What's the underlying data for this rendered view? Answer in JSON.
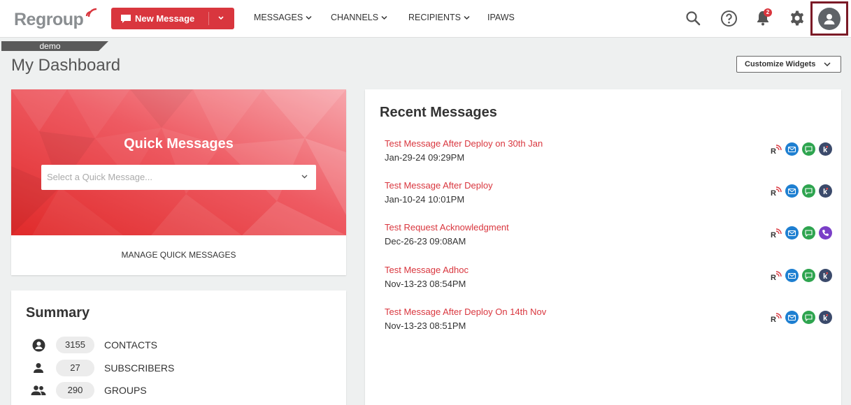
{
  "header": {
    "logo_text": "Regroup",
    "new_message_label": "New Message",
    "nav": [
      {
        "label": "MESSAGES"
      },
      {
        "label": "CHANNELS"
      },
      {
        "label": "RECIPIENTS"
      },
      {
        "label": "IPAWS"
      }
    ],
    "notification_count": "2",
    "icons": [
      "search-icon",
      "help-icon",
      "bell-icon",
      "gear-icon",
      "user-avatar-icon"
    ]
  },
  "org_tag": "demo",
  "page_title": "My Dashboard",
  "customize_label": "Customize Widgets",
  "quick_messages": {
    "title": "Quick Messages",
    "select_placeholder": "Select a Quick Message...",
    "manage_label": "MANAGE QUICK MESSAGES"
  },
  "summary": {
    "title": "Summary",
    "rows": [
      {
        "icon": "contact-circle-icon",
        "count": "3155",
        "label": "CONTACTS"
      },
      {
        "icon": "person-icon",
        "count": "27",
        "label": "SUBSCRIBERS"
      },
      {
        "icon": "group-icon",
        "count": "290",
        "label": "GROUPS"
      }
    ]
  },
  "recent_messages": {
    "title": "Recent Messages",
    "items": [
      {
        "subject": "Test Message After Deploy on 30th Jan",
        "date": "Jan-29-24 09:29PM",
        "channels": [
          "rss",
          "email",
          "sms",
          "kiosk"
        ]
      },
      {
        "subject": "Test Message After Deploy",
        "date": "Jan-10-24 10:01PM",
        "channels": [
          "rss",
          "email",
          "sms",
          "kiosk"
        ]
      },
      {
        "subject": "Test Request Acknowledgment",
        "date": "Dec-26-23 09:08AM",
        "channels": [
          "rss",
          "email",
          "sms",
          "voice"
        ]
      },
      {
        "subject": "Test Message Adhoc",
        "date": "Nov-13-23 08:54PM",
        "channels": [
          "rss",
          "email",
          "sms",
          "kiosk"
        ]
      },
      {
        "subject": "Test Message After Deploy On 14th Nov",
        "date": "Nov-13-23 08:51PM",
        "channels": [
          "rss",
          "email",
          "sms",
          "kiosk"
        ]
      }
    ]
  },
  "colors": {
    "brand_red": "#d9363e",
    "avatar_highlight": "#7b1a26",
    "email_blue": "#1e7fd1",
    "sms_green": "#2ea44f",
    "kiosk_navy": "#3b4a6b",
    "voice_purple": "#7a3fc7"
  }
}
